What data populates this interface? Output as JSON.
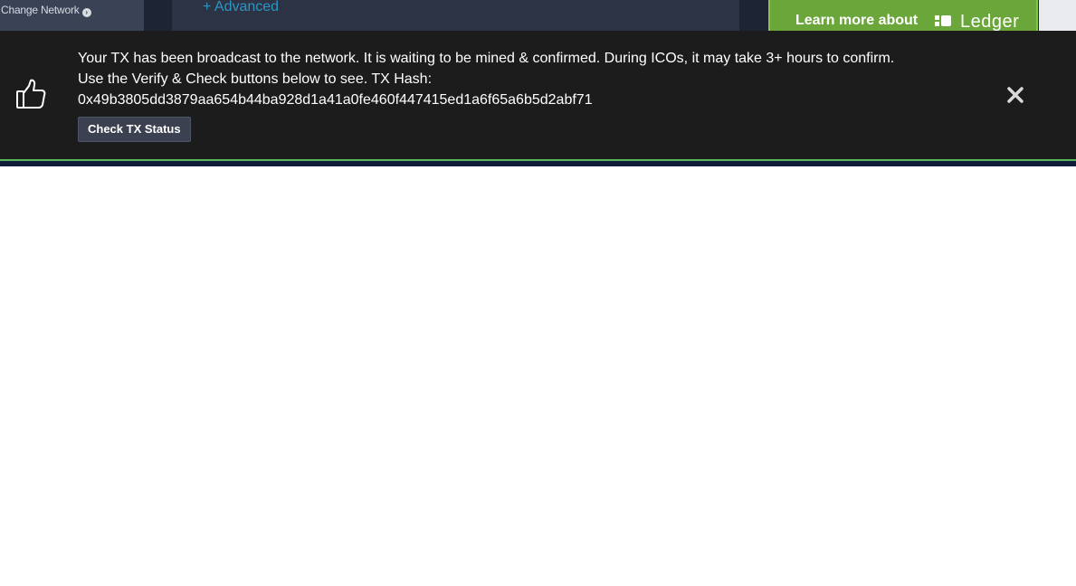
{
  "background": {
    "sidebar": {
      "change_network_label": "Change Network",
      "change_network_icon": "arrow-circle-right-icon"
    },
    "main": {
      "advanced_link": "+ Advanced"
    },
    "promo": {
      "text": "Learn more about",
      "brand": "Ledger",
      "color": "#6aa63a"
    }
  },
  "notification": {
    "icon": "thumbs-up-icon",
    "message_line1": "Your TX has been broadcast to the network. It is waiting to be mined & confirmed. During ICOs, it may take 3+ hours to confirm.",
    "message_line2": "Use the Verify & Check buttons below to see. TX Hash:",
    "tx_hash": "0x49b3805dd3879aa654b44ba928d1a41a0fe460f447415ed1a6f65a6b5d2abf71",
    "check_button_label": "Check TX Status",
    "close_icon": "close-icon",
    "background_color": "#1c1c1c"
  }
}
